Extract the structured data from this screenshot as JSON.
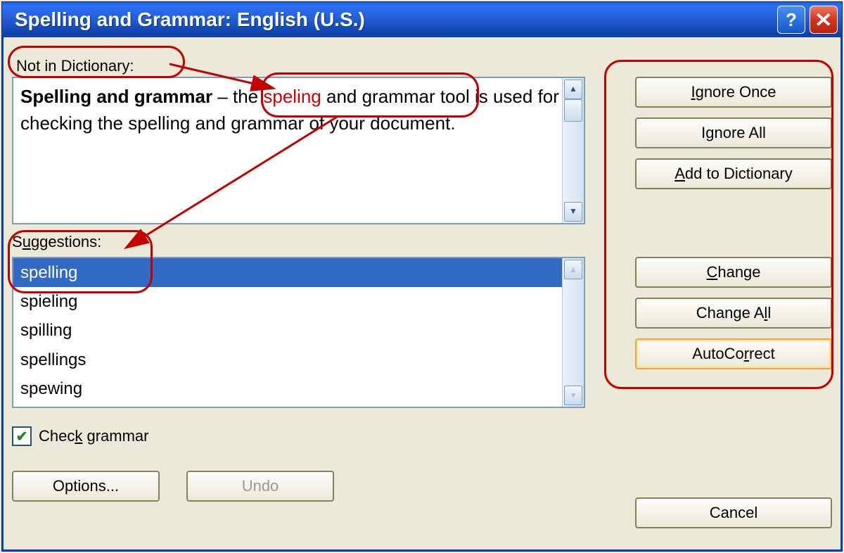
{
  "titlebar": {
    "title": "Spelling and Grammar: English (U.S.)",
    "help_glyph": "?",
    "close_glyph": "✕"
  },
  "labels": {
    "not_in_dictionary": "Not in Dictionary:",
    "suggestions": "Suggestions:",
    "check_grammar": "Check grammar"
  },
  "sentence": {
    "bold_part": "Spelling and grammar",
    "sep": " – the ",
    "error_word": "speling",
    "tail": " and grammar tool is used for checking the spelling and grammar of your document."
  },
  "suggestions_list": [
    "spelling",
    "spieling",
    "spilling",
    "spellings",
    "spewing"
  ],
  "selected_suggestion_index": 0,
  "buttons": {
    "ignore_once": "Ignore Once",
    "ignore_all": "Ignore All",
    "add_to_dictionary": "Add to Dictionary",
    "change": "Change",
    "change_all": "Change All",
    "autocorrect": "AutoCorrect",
    "options": "Options...",
    "undo": "Undo",
    "cancel": "Cancel"
  },
  "checkbox": {
    "checked": true,
    "mark": "✔"
  },
  "scroll": {
    "up": "▲",
    "down": "▼"
  }
}
